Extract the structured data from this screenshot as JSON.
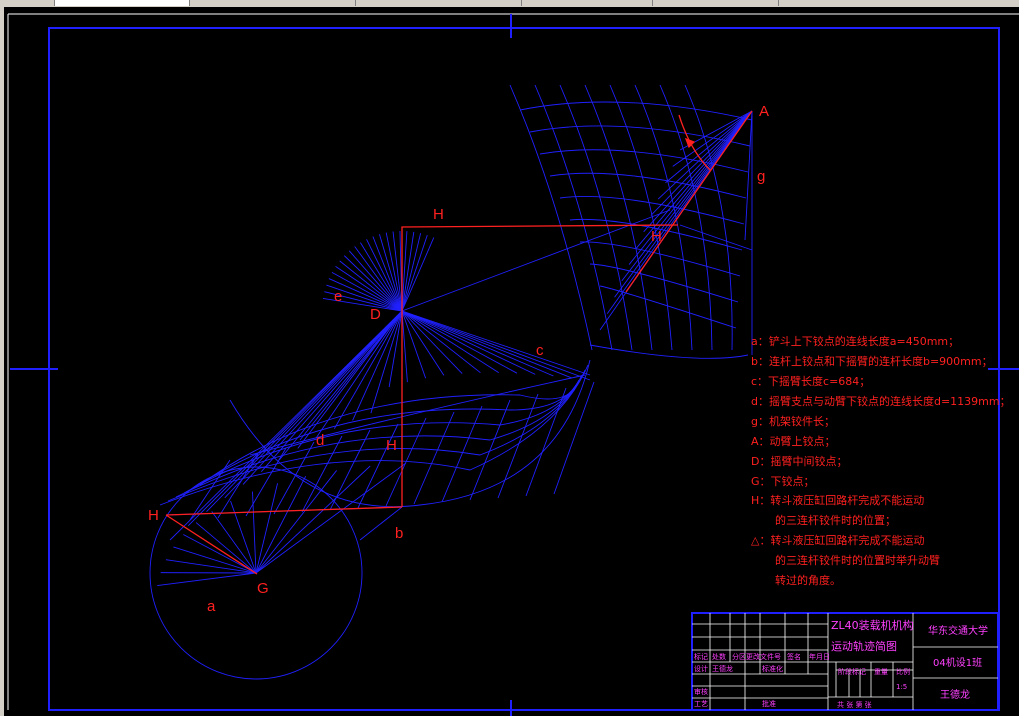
{
  "colors": {
    "background": "#000000",
    "blue": "#2020ff",
    "red": "#ff2020",
    "magenta": "#ff40ff"
  },
  "labels": {
    "A": "A",
    "g": "g",
    "H_top": "H",
    "H_right": "H",
    "H_mid": "H",
    "H_left": "H",
    "e": "e",
    "D": "D",
    "c": "c",
    "d": "d",
    "b": "b",
    "G": "G",
    "a": "a"
  },
  "legend": [
    "a：铲斗上下铰点的连线长度a=450mm；",
    "b：连杆上铰点和下摇臂的连杆长度b=900mm；",
    "c：下摇臂长度c=684；",
    "d：摇臂支点与动臂下铰点的连线长度d=1139mm；",
    "g：机架铰件长；",
    "A：动臂上铰点；",
    "D：摇臂中间铰点；",
    "G：下铰点；",
    "H：转斗液压缸回路杆完成不能运动",
    "的三连杆铰件时的位置；",
    "△：转斗液压缸回路杆完成不能运动",
    "的三连杆铰件时的位置时举升动臂",
    "转过的角度。"
  ],
  "title_block": {
    "drawing_title_1": "ZL40装载机机构",
    "drawing_title_2": "运动轨迹简图",
    "school": "华东交通大学",
    "class": "04机设1班",
    "author": "王德龙",
    "row_labels": [
      "标记",
      "处数",
      "分区",
      "更改文件号",
      "签名",
      "年月日"
    ],
    "design_row": [
      "设计",
      "王德龙",
      "标准化"
    ],
    "check_label": "审核",
    "process_label": "工艺",
    "approve_label": "批准",
    "stage_labels": [
      "阶段标记",
      "重量",
      "比例"
    ],
    "scale_value": "1:5",
    "sheet_text": "共  张 第  张"
  }
}
